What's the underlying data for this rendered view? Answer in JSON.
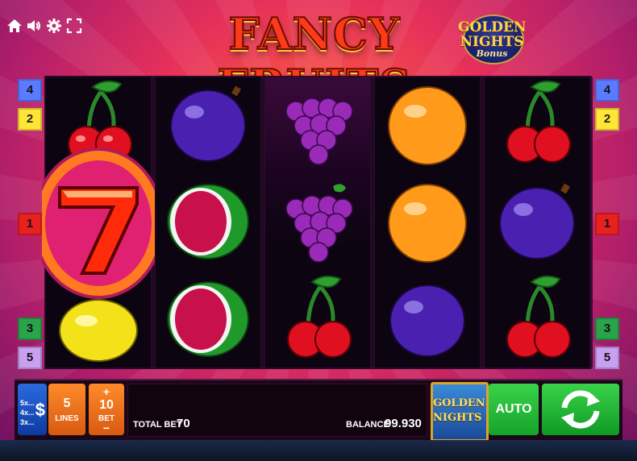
{
  "game_title": "FANCY FRUITS",
  "bonus_logo": {
    "line1": "GOLDEN",
    "line2": "NIGHTS",
    "line3": "Bonus"
  },
  "top_icons": [
    "home-icon",
    "speaker-icon",
    "settings-icon",
    "fullscreen-icon"
  ],
  "reels": [
    [
      "cherry",
      "seven",
      "lemon"
    ],
    [
      "plum",
      "watermelon",
      "watermelon"
    ],
    [
      "grapes",
      "grapes",
      "cherry"
    ],
    [
      "orange",
      "orange",
      "plum"
    ],
    [
      "cherry",
      "plum",
      "cherry"
    ]
  ],
  "line_markers_left": [
    {
      "label": "4",
      "color": "blue"
    },
    {
      "label": "2",
      "color": "yellow"
    },
    {
      "label": "1",
      "color": "red"
    },
    {
      "label": "3",
      "color": "green"
    },
    {
      "label": "5",
      "color": "purple"
    }
  ],
  "line_markers_right": [
    {
      "label": "4",
      "color": "blue"
    },
    {
      "label": "2",
      "color": "yellow"
    },
    {
      "label": "1",
      "color": "red"
    },
    {
      "label": "3",
      "color": "green"
    },
    {
      "label": "5",
      "color": "purple"
    }
  ],
  "controls": {
    "paytable": {
      "mults": [
        "5x...",
        "4x...",
        "3x..."
      ],
      "symbol": "$"
    },
    "lines": {
      "value": "5",
      "label": "LINES"
    },
    "bet": {
      "plus": "+",
      "value": "10",
      "label": "BET",
      "minus": "−"
    },
    "total_bet_label": "TOTAL BET",
    "total_bet_value": "70",
    "balance_label": "BALANCE",
    "balance_value": "99.930",
    "golden_nights_button": {
      "line1": "GOLDEN",
      "line2": "NIGHTS"
    },
    "auto_label": "AUTO"
  },
  "colors": {
    "marker_blue": "#5a7aff",
    "marker_yellow": "#ffe536",
    "marker_red": "#e82020",
    "marker_green": "#2aa34a",
    "marker_purple": "#c9a0f0",
    "spin_green": "#15a42a",
    "orange_button": "#ff8a2a"
  }
}
